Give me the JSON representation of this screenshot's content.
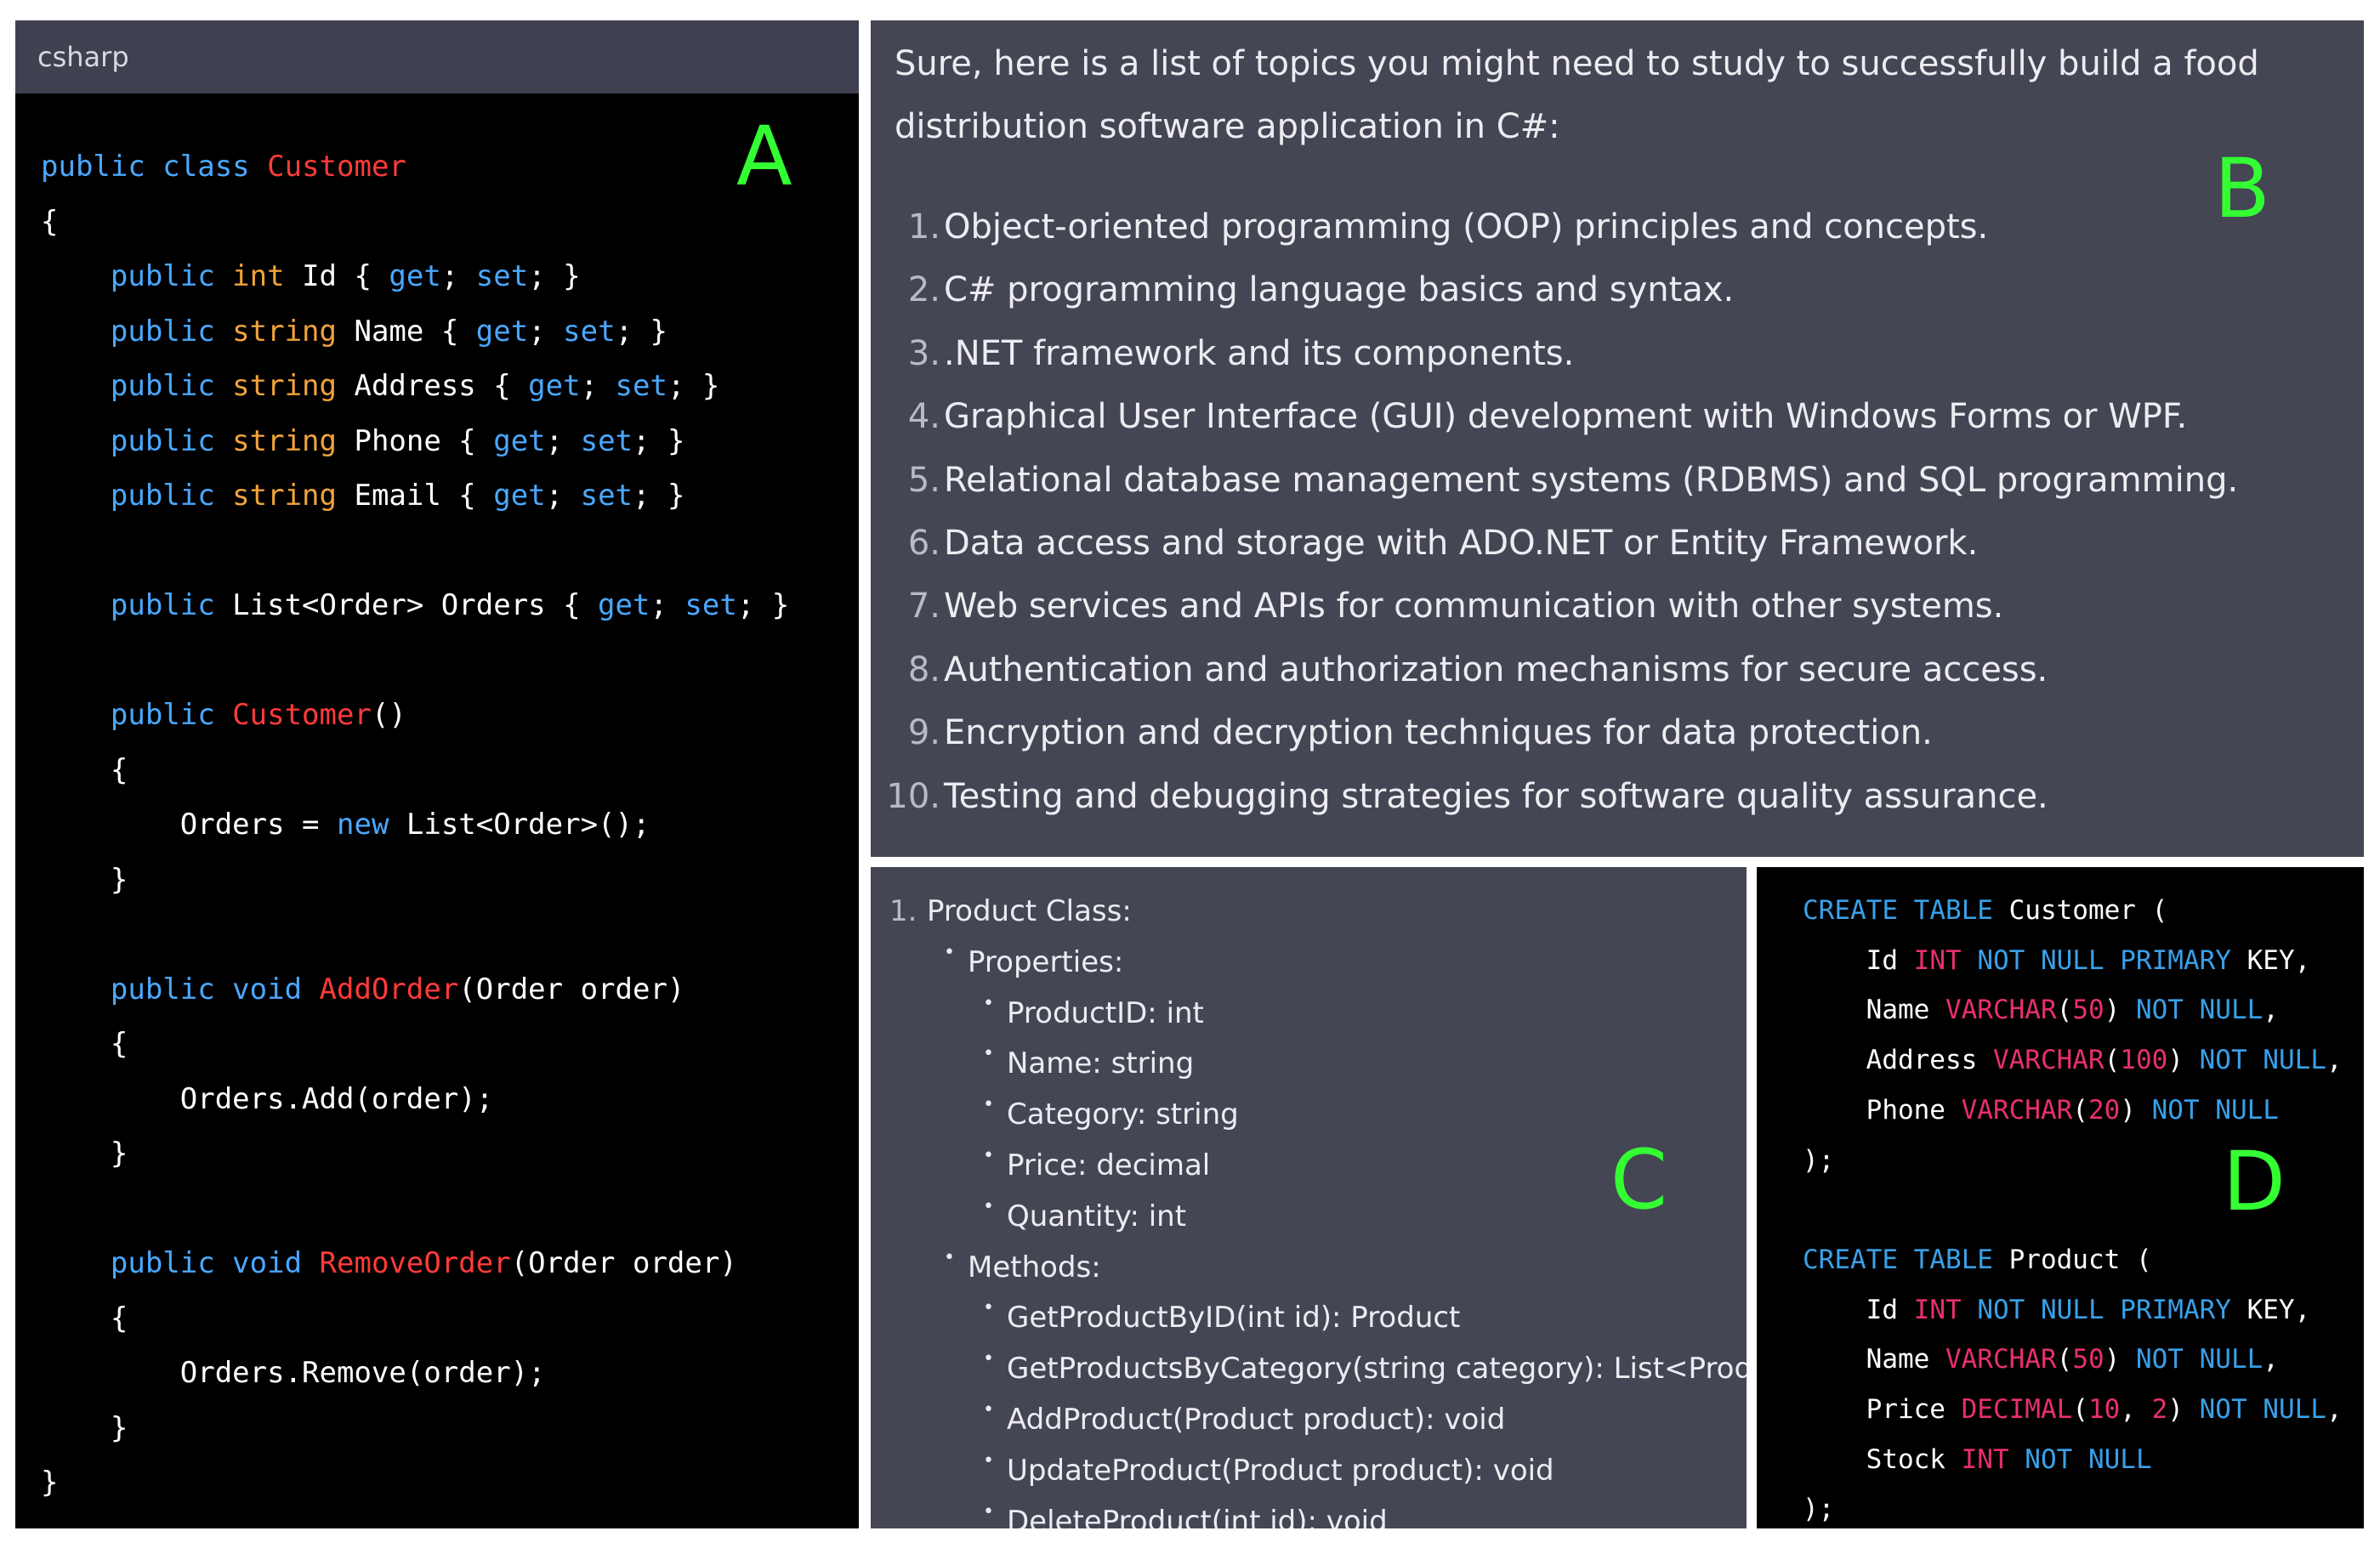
{
  "panelA": {
    "language_label": "csharp",
    "letter": "A",
    "lines": [
      [
        {
          "t": "public ",
          "c": "kw"
        },
        {
          "t": "class ",
          "c": "kw"
        },
        {
          "t": "Customer",
          "c": "fn"
        }
      ],
      [
        {
          "t": "{",
          "c": ""
        }
      ],
      [
        {
          "t": "    public ",
          "c": "kw"
        },
        {
          "t": "int ",
          "c": "ty"
        },
        {
          "t": "Id { ",
          "c": ""
        },
        {
          "t": "get",
          "c": "kw"
        },
        {
          "t": "; ",
          "c": ""
        },
        {
          "t": "set",
          "c": "kw"
        },
        {
          "t": "; }",
          "c": ""
        }
      ],
      [
        {
          "t": "    public ",
          "c": "kw"
        },
        {
          "t": "string ",
          "c": "ty"
        },
        {
          "t": "Name { ",
          "c": ""
        },
        {
          "t": "get",
          "c": "kw"
        },
        {
          "t": "; ",
          "c": ""
        },
        {
          "t": "set",
          "c": "kw"
        },
        {
          "t": "; }",
          "c": ""
        }
      ],
      [
        {
          "t": "    public ",
          "c": "kw"
        },
        {
          "t": "string ",
          "c": "ty"
        },
        {
          "t": "Address { ",
          "c": ""
        },
        {
          "t": "get",
          "c": "kw"
        },
        {
          "t": "; ",
          "c": ""
        },
        {
          "t": "set",
          "c": "kw"
        },
        {
          "t": "; }",
          "c": ""
        }
      ],
      [
        {
          "t": "    public ",
          "c": "kw"
        },
        {
          "t": "string ",
          "c": "ty"
        },
        {
          "t": "Phone { ",
          "c": ""
        },
        {
          "t": "get",
          "c": "kw"
        },
        {
          "t": "; ",
          "c": ""
        },
        {
          "t": "set",
          "c": "kw"
        },
        {
          "t": "; }",
          "c": ""
        }
      ],
      [
        {
          "t": "    public ",
          "c": "kw"
        },
        {
          "t": "string ",
          "c": "ty"
        },
        {
          "t": "Email { ",
          "c": ""
        },
        {
          "t": "get",
          "c": "kw"
        },
        {
          "t": "; ",
          "c": ""
        },
        {
          "t": "set",
          "c": "kw"
        },
        {
          "t": "; }",
          "c": ""
        }
      ],
      [
        {
          "t": "",
          "c": ""
        }
      ],
      [
        {
          "t": "    public ",
          "c": "kw"
        },
        {
          "t": "List<Order> Orders { ",
          "c": ""
        },
        {
          "t": "get",
          "c": "kw"
        },
        {
          "t": "; ",
          "c": ""
        },
        {
          "t": "set",
          "c": "kw"
        },
        {
          "t": "; }",
          "c": ""
        }
      ],
      [
        {
          "t": "",
          "c": ""
        }
      ],
      [
        {
          "t": "    public ",
          "c": "kw"
        },
        {
          "t": "Customer",
          "c": "fn"
        },
        {
          "t": "()",
          "c": ""
        }
      ],
      [
        {
          "t": "    {",
          "c": ""
        }
      ],
      [
        {
          "t": "        Orders = ",
          "c": ""
        },
        {
          "t": "new ",
          "c": "kw"
        },
        {
          "t": "List<Order>();",
          "c": ""
        }
      ],
      [
        {
          "t": "    }",
          "c": ""
        }
      ],
      [
        {
          "t": "",
          "c": ""
        }
      ],
      [
        {
          "t": "    public ",
          "c": "kw"
        },
        {
          "t": "void ",
          "c": "kw"
        },
        {
          "t": "AddOrder",
          "c": "fn"
        },
        {
          "t": "(Order order)",
          "c": ""
        }
      ],
      [
        {
          "t": "    {",
          "c": ""
        }
      ],
      [
        {
          "t": "        Orders.Add(order);",
          "c": ""
        }
      ],
      [
        {
          "t": "    }",
          "c": ""
        }
      ],
      [
        {
          "t": "",
          "c": ""
        }
      ],
      [
        {
          "t": "    public ",
          "c": "kw"
        },
        {
          "t": "void ",
          "c": "kw"
        },
        {
          "t": "RemoveOrder",
          "c": "fn"
        },
        {
          "t": "(Order order)",
          "c": ""
        }
      ],
      [
        {
          "t": "    {",
          "c": ""
        }
      ],
      [
        {
          "t": "        Orders.Remove(order);",
          "c": ""
        }
      ],
      [
        {
          "t": "    }",
          "c": ""
        }
      ],
      [
        {
          "t": "}",
          "c": ""
        }
      ]
    ]
  },
  "panelB": {
    "letter": "B",
    "intro": "Sure, here is a list of topics you might need to study to successfully build a food distribution software application in C#:",
    "items": [
      {
        "num": "1.",
        "text": "Object-oriented programming (OOP) principles and concepts."
      },
      {
        "num": "2.",
        "text": "C# programming language basics and syntax."
      },
      {
        "num": "3.",
        "text": ".NET framework and its components."
      },
      {
        "num": "4.",
        "text": "Graphical User Interface (GUI) development with Windows Forms or WPF."
      },
      {
        "num": "5.",
        "text": "Relational database management systems (RDBMS) and SQL programming."
      },
      {
        "num": "6.",
        "text": "Data access and storage with ADO.NET or Entity Framework."
      },
      {
        "num": "7.",
        "text": "Web services and APIs for communication with other systems."
      },
      {
        "num": "8.",
        "text": "Authentication and authorization mechanisms for secure access."
      },
      {
        "num": "9.",
        "text": "Encryption and decryption techniques for data protection."
      },
      {
        "num": "10.",
        "text": "Testing and debugging strategies for software quality assurance."
      }
    ]
  },
  "panelC": {
    "letter": "C",
    "lines": [
      {
        "level": 0,
        "marker": "1.",
        "text": "Product Class:"
      },
      {
        "level": 1,
        "marker": "•",
        "text": "Properties:"
      },
      {
        "level": 2,
        "marker": "•",
        "text": "ProductID: int"
      },
      {
        "level": 2,
        "marker": "•",
        "text": "Name: string"
      },
      {
        "level": 2,
        "marker": "•",
        "text": "Category: string"
      },
      {
        "level": 2,
        "marker": "•",
        "text": "Price: decimal"
      },
      {
        "level": 2,
        "marker": "•",
        "text": "Quantity: int"
      },
      {
        "level": 1,
        "marker": "•",
        "text": "Methods:"
      },
      {
        "level": 2,
        "marker": "•",
        "text": "GetProductByID(int id): Product"
      },
      {
        "level": 2,
        "marker": "•",
        "text": "GetProductsByCategory(string category): List<Product>"
      },
      {
        "level": 2,
        "marker": "•",
        "text": "AddProduct(Product product): void"
      },
      {
        "level": 2,
        "marker": "•",
        "text": "UpdateProduct(Product product): void"
      },
      {
        "level": 2,
        "marker": "•",
        "text": "DeleteProduct(int id): void"
      }
    ]
  },
  "panelD": {
    "letter": "D",
    "lines": [
      [
        {
          "t": "CREATE ",
          "c": "sql-kw"
        },
        {
          "t": "TABLE ",
          "c": "sql-kw"
        },
        {
          "t": "Customer (",
          "c": ""
        }
      ],
      [
        {
          "t": "    Id ",
          "c": ""
        },
        {
          "t": "INT ",
          "c": "sql-ty"
        },
        {
          "t": "NOT ",
          "c": "sql-kw"
        },
        {
          "t": "NULL ",
          "c": "sql-kw"
        },
        {
          "t": "PRIMARY ",
          "c": "sql-kw"
        },
        {
          "t": "KEY,",
          "c": ""
        }
      ],
      [
        {
          "t": "    Name ",
          "c": ""
        },
        {
          "t": "VARCHAR",
          "c": "sql-ty"
        },
        {
          "t": "(",
          "c": ""
        },
        {
          "t": "50",
          "c": "sql-num"
        },
        {
          "t": ") ",
          "c": ""
        },
        {
          "t": "NOT ",
          "c": "sql-kw"
        },
        {
          "t": "NULL",
          "c": "sql-kw"
        },
        {
          "t": ",",
          "c": ""
        }
      ],
      [
        {
          "t": "    Address ",
          "c": ""
        },
        {
          "t": "VARCHAR",
          "c": "sql-ty"
        },
        {
          "t": "(",
          "c": ""
        },
        {
          "t": "100",
          "c": "sql-num"
        },
        {
          "t": ") ",
          "c": ""
        },
        {
          "t": "NOT ",
          "c": "sql-kw"
        },
        {
          "t": "NULL",
          "c": "sql-kw"
        },
        {
          "t": ",",
          "c": ""
        }
      ],
      [
        {
          "t": "    Phone ",
          "c": ""
        },
        {
          "t": "VARCHAR",
          "c": "sql-ty"
        },
        {
          "t": "(",
          "c": ""
        },
        {
          "t": "20",
          "c": "sql-num"
        },
        {
          "t": ") ",
          "c": ""
        },
        {
          "t": "NOT ",
          "c": "sql-kw"
        },
        {
          "t": "NULL",
          "c": "sql-kw"
        }
      ],
      [
        {
          "t": ");",
          "c": ""
        }
      ],
      [
        {
          "t": "",
          "c": ""
        }
      ],
      [
        {
          "t": "CREATE ",
          "c": "sql-kw"
        },
        {
          "t": "TABLE ",
          "c": "sql-kw"
        },
        {
          "t": "Product (",
          "c": ""
        }
      ],
      [
        {
          "t": "    Id ",
          "c": ""
        },
        {
          "t": "INT ",
          "c": "sql-ty"
        },
        {
          "t": "NOT ",
          "c": "sql-kw"
        },
        {
          "t": "NULL ",
          "c": "sql-kw"
        },
        {
          "t": "PRIMARY ",
          "c": "sql-kw"
        },
        {
          "t": "KEY,",
          "c": ""
        }
      ],
      [
        {
          "t": "    Name ",
          "c": ""
        },
        {
          "t": "VARCHAR",
          "c": "sql-ty"
        },
        {
          "t": "(",
          "c": ""
        },
        {
          "t": "50",
          "c": "sql-num"
        },
        {
          "t": ") ",
          "c": ""
        },
        {
          "t": "NOT ",
          "c": "sql-kw"
        },
        {
          "t": "NULL",
          "c": "sql-kw"
        },
        {
          "t": ",",
          "c": ""
        }
      ],
      [
        {
          "t": "    Price ",
          "c": ""
        },
        {
          "t": "DECIMAL",
          "c": "sql-ty"
        },
        {
          "t": "(",
          "c": ""
        },
        {
          "t": "10",
          "c": "sql-num"
        },
        {
          "t": ", ",
          "c": ""
        },
        {
          "t": "2",
          "c": "sql-num"
        },
        {
          "t": ") ",
          "c": ""
        },
        {
          "t": "NOT ",
          "c": "sql-kw"
        },
        {
          "t": "NULL",
          "c": "sql-kw"
        },
        {
          "t": ",",
          "c": ""
        }
      ],
      [
        {
          "t": "    Stock ",
          "c": ""
        },
        {
          "t": "INT ",
          "c": "sql-ty"
        },
        {
          "t": "NOT ",
          "c": "sql-kw"
        },
        {
          "t": "NULL",
          "c": "sql-kw"
        }
      ],
      [
        {
          "t": ");",
          "c": ""
        }
      ]
    ]
  }
}
